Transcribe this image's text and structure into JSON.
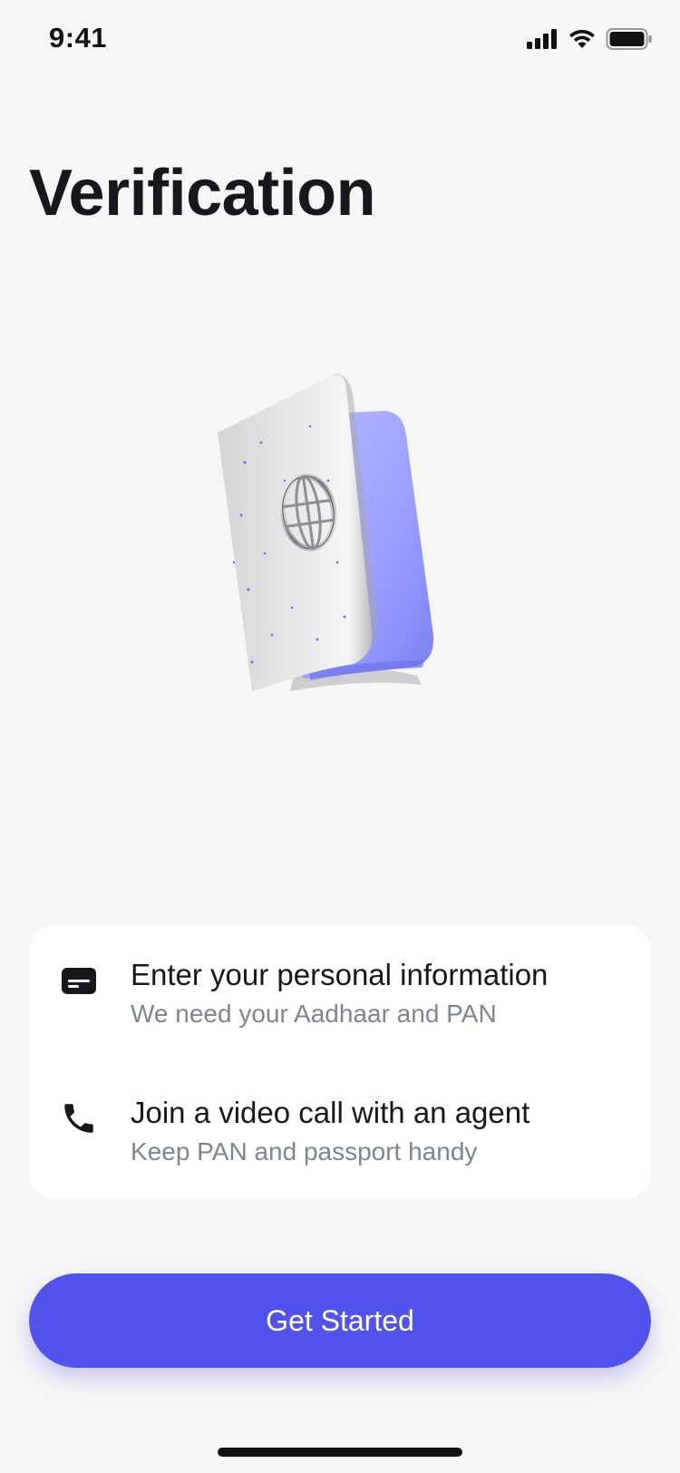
{
  "status_bar": {
    "time": "9:41",
    "icons": [
      "signal-icon",
      "wifi-icon",
      "battery-icon"
    ]
  },
  "page": {
    "title": "Verification"
  },
  "illustration": {
    "name": "passport-illustration",
    "emblem": "globe-icon"
  },
  "info_card": {
    "items": [
      {
        "icon": "id-card-icon",
        "title": "Enter your personal information",
        "subtitle": "We need your Aadhaar and PAN"
      },
      {
        "icon": "phone-icon",
        "title": "Join a video call with an agent",
        "subtitle": "Keep PAN and passport handy"
      }
    ]
  },
  "actions": {
    "primary_label": "Get Started"
  },
  "colors": {
    "background": "#f6f6f7",
    "accent": "#5054ea",
    "text_primary": "#16181d",
    "text_secondary": "#7e8591",
    "card": "#ffffff"
  }
}
